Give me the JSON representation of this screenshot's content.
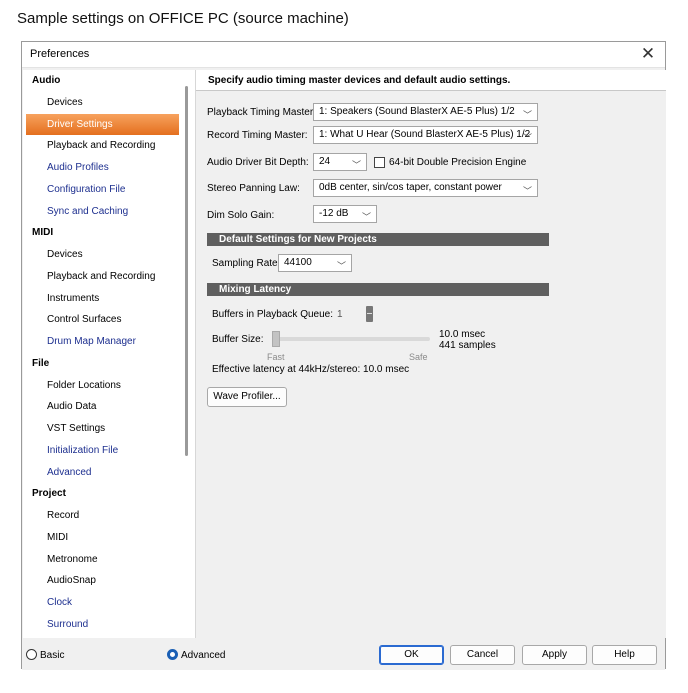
{
  "caption": "Sample settings on OFFICE PC (source machine)",
  "window": {
    "title": "Preferences",
    "close_glyph": "✕"
  },
  "sidebar": {
    "groups": [
      {
        "label": "Audio",
        "items": [
          {
            "label": "Devices",
            "style": "normal"
          },
          {
            "label": "Driver Settings",
            "style": "selected"
          },
          {
            "label": "Playback and Recording",
            "style": "normal"
          },
          {
            "label": "Audio Profiles",
            "style": "link"
          },
          {
            "label": "Configuration File",
            "style": "link"
          },
          {
            "label": "Sync and Caching",
            "style": "link"
          }
        ]
      },
      {
        "label": "MIDI",
        "items": [
          {
            "label": "Devices",
            "style": "normal"
          },
          {
            "label": "Playback and Recording",
            "style": "normal"
          },
          {
            "label": "Instruments",
            "style": "normal"
          },
          {
            "label": "Control Surfaces",
            "style": "normal"
          },
          {
            "label": "Drum Map Manager",
            "style": "link"
          }
        ]
      },
      {
        "label": "File",
        "items": [
          {
            "label": "Folder Locations",
            "style": "normal"
          },
          {
            "label": "Audio Data",
            "style": "normal"
          },
          {
            "label": "VST Settings",
            "style": "normal"
          },
          {
            "label": "Initialization File",
            "style": "link"
          },
          {
            "label": "Advanced",
            "style": "link"
          }
        ]
      },
      {
        "label": "Project",
        "items": [
          {
            "label": "Record",
            "style": "normal"
          },
          {
            "label": "MIDI",
            "style": "normal"
          },
          {
            "label": "Metronome",
            "style": "normal"
          },
          {
            "label": "AudioSnap",
            "style": "normal"
          },
          {
            "label": "Clock",
            "style": "link"
          },
          {
            "label": "Surround",
            "style": "link"
          }
        ]
      }
    ]
  },
  "panel": {
    "header": "Specify audio timing master devices and default audio settings.",
    "playback_master": {
      "label": "Playback Timing Master:",
      "value": "1: Speakers (Sound BlasterX AE-5 Plus) 1/2"
    },
    "record_master": {
      "label": "Record Timing Master:",
      "value": "1: What U Hear (Sound BlasterX AE-5 Plus) 1/2"
    },
    "bit_depth": {
      "label": "Audio Driver Bit Depth:",
      "value": "24"
    },
    "double_precision": {
      "label": "64-bit Double Precision Engine",
      "checked": false
    },
    "panning": {
      "label": "Stereo Panning Law:",
      "value": "0dB center, sin/cos taper, constant power"
    },
    "dim_solo": {
      "label": "Dim Solo Gain:",
      "value": "-12 dB"
    },
    "defaults_section": "Default Settings for New Projects",
    "sampling_rate": {
      "label": "Sampling Rate:",
      "value": "44100"
    },
    "latency_section": "Mixing Latency",
    "buffers": {
      "label": "Buffers in Playback Queue:",
      "value": "1"
    },
    "buffer_size": {
      "label": "Buffer Size:",
      "msec": "10.0 msec",
      "samples": "441 samples",
      "fast": "Fast",
      "safe": "Safe",
      "level": 0.0
    },
    "effective_latency": "Effective latency at 44kHz/stereo:  10.0 msec",
    "wave_profiler": "Wave Profiler..."
  },
  "footer": {
    "basic": "Basic",
    "advanced": "Advanced",
    "mode": "advanced",
    "ok": "OK",
    "cancel": "Cancel",
    "apply": "Apply",
    "help": "Help"
  },
  "colors": {
    "selected_start": "#f7a25e",
    "selected_end": "#e46f1e",
    "link": "#1d2f8f",
    "section_bg": "#5f5f5f"
  }
}
